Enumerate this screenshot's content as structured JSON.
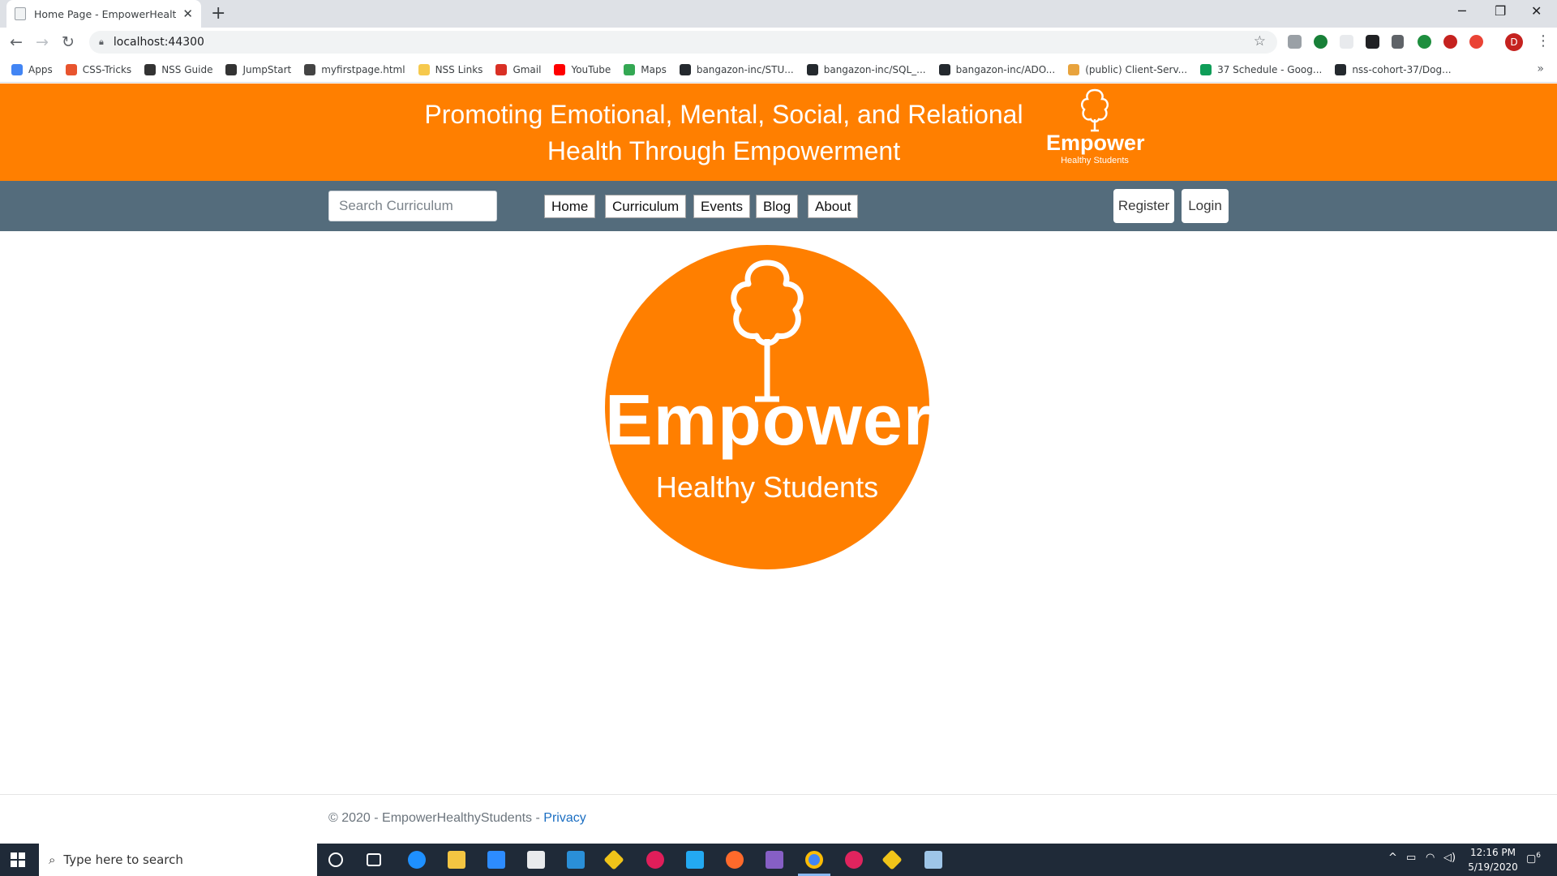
{
  "browser": {
    "tab_title": "Home Page - EmpowerHealthySt",
    "url": "localhost:44300",
    "profile_initial": "D",
    "window_controls": {
      "minimize": "─",
      "restore": "❐",
      "close": "✕"
    },
    "bookmarks": [
      {
        "label": "Apps",
        "icon": "apps-grid-icon",
        "color": "#4285f4"
      },
      {
        "label": "CSS-Tricks",
        "icon": "css-tricks-icon",
        "color": "#e8542e"
      },
      {
        "label": "NSS Guide",
        "icon": "nss-icon",
        "color": "#333333"
      },
      {
        "label": "JumpStart",
        "icon": "nss-icon",
        "color": "#333333"
      },
      {
        "label": "myfirstpage.html",
        "icon": "globe-icon",
        "color": "#444444"
      },
      {
        "label": "NSS Links",
        "icon": "folder-icon",
        "color": "#f6c94d"
      },
      {
        "label": "Gmail",
        "icon": "gmail-icon",
        "color": "#d93025"
      },
      {
        "label": "YouTube",
        "icon": "youtube-icon",
        "color": "#ff0000"
      },
      {
        "label": "Maps",
        "icon": "maps-icon",
        "color": "#34a853"
      },
      {
        "label": "bangazon-inc/STU...",
        "icon": "github-icon",
        "color": "#24292e"
      },
      {
        "label": "bangazon-inc/SQL_...",
        "icon": "github-icon",
        "color": "#24292e"
      },
      {
        "label": "bangazon-inc/ADO...",
        "icon": "github-icon",
        "color": "#24292e"
      },
      {
        "label": "(public) Client-Serv...",
        "icon": "dollar-icon",
        "color": "#e8a33d"
      },
      {
        "label": "37 Schedule - Goog...",
        "icon": "sheets-icon",
        "color": "#0f9d58"
      },
      {
        "label": "nss-cohort-37/Dog...",
        "icon": "github-icon",
        "color": "#24292e"
      }
    ],
    "more_bookmarks": "»"
  },
  "header": {
    "tagline": "Promoting Emotional, Mental, Social, and Relational Health Through Empowerment",
    "logo_name": "Empower",
    "logo_sub": "Healthy Students",
    "brand_color": "#ff7f00"
  },
  "nav": {
    "search_placeholder": "Search Curriculum",
    "links": [
      "Home",
      "Curriculum",
      "Events",
      "Blog",
      "About"
    ],
    "register": "Register",
    "login": "Login",
    "bar_color": "#546c7c"
  },
  "hero": {
    "name": "Empower",
    "sub": "Healthy Students"
  },
  "footer": {
    "copyright": "© 2020 - EmpowerHealthyStudents -",
    "privacy": "Privacy"
  },
  "taskbar": {
    "search_placeholder": "Type here to search",
    "time": "12:16 PM",
    "date": "5/19/2020",
    "notification_count": "6"
  }
}
